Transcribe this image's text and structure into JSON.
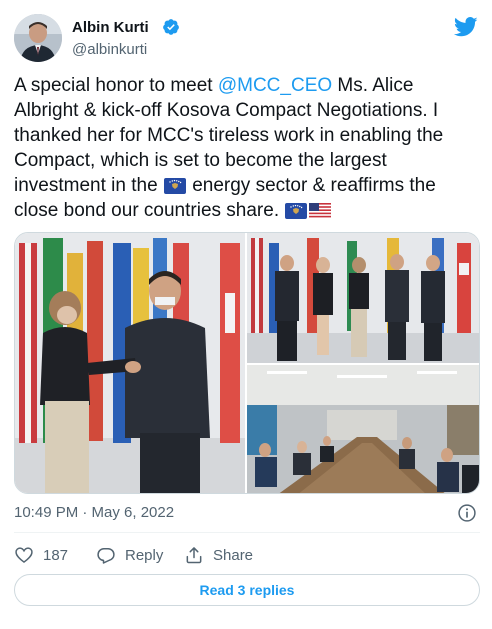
{
  "author": {
    "name": "Albin Kurti",
    "handle": "@albinkurti",
    "verified": true
  },
  "tweet": {
    "text_before": "A special honor to meet ",
    "mention": "@MCC_CEO",
    "text_middle": " Ms. Alice Albright & kick-off Kosova Compact Negotiations. I thanked her for MCC's tireless work in enabling the Compact, which is set to become the largest investment in the ",
    "text_after": " energy sector & reaffirms the close bond our countries share. "
  },
  "media": {
    "photos": [
      "handshake-photo",
      "group-photo",
      "meeting-room-photo"
    ]
  },
  "meta": {
    "timestamp": "10:49 PM · May 6, 2022"
  },
  "actions": {
    "like_count": "187",
    "reply_label": "Reply",
    "share_label": "Share"
  },
  "footer": {
    "read_replies_label": "Read 3 replies"
  },
  "colors": {
    "accent": "#1d9bf0",
    "secondary_text": "#536471",
    "border": "#cfd9de",
    "like_icon": "#536471"
  },
  "icons": [
    "verified-badge-icon",
    "twitter-bird-icon",
    "info-icon",
    "heart-icon",
    "reply-icon",
    "share-icon",
    "kosovo-flag-icon",
    "usa-flag-icon"
  ]
}
